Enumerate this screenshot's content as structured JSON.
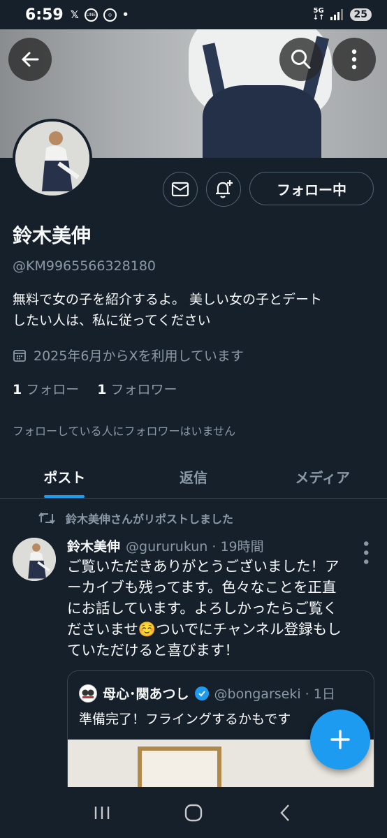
{
  "status_bar": {
    "time": "6:59",
    "network": "5G",
    "battery": "25",
    "apps": [
      "x-icon",
      "line-icon",
      "chrome-icon",
      "dot"
    ]
  },
  "profile": {
    "name": "鈴木美伸",
    "handle": "@KM9965566328180",
    "bio_line1": "無料で女の子を紹介するよ。 美しい女の子とデート",
    "bio_line2": "したい人は、私に従ってください",
    "joined": "2025年6月からXを利用しています",
    "following_count": "1",
    "following_label": "フォロー",
    "followers_count": "1",
    "followers_label": "フォロワー",
    "no_followers_note": "フォローしている人にフォロワーはいません",
    "follow_button": "フォロー中"
  },
  "tabs": [
    {
      "label": "ポスト",
      "active": true
    },
    {
      "label": "返信",
      "active": false
    },
    {
      "label": "メディア",
      "active": false
    }
  ],
  "tweet": {
    "repost_label": "鈴木美伸さんがリポストしました",
    "author_name": "鈴木美伸",
    "author_handle_time": "@gururukun · 19時間",
    "lines": [
      "ご覧いただきありがとうございました！ア",
      "ーカイブも残ってます。色々なことを正直",
      "にお話しています。よろしかったらご覧く",
      "ださいませ☺️ついでにチャンネル登録もし",
      "ていただけると喜びます！"
    ]
  },
  "quote": {
    "name": "母心･関あつし",
    "handle_time": "@bongarseki · 1日",
    "text": "準備完了！フライングするかもです"
  },
  "colors": {
    "background": "#15202b",
    "accent": "#1d9bf0",
    "secondary_text": "#8b98a5",
    "border": "#38444d"
  }
}
